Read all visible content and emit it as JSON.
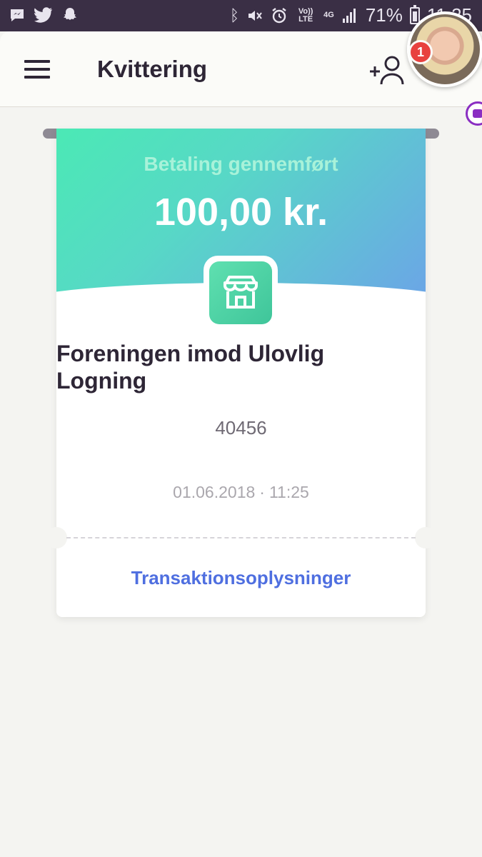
{
  "status_bar": {
    "battery": "71%",
    "time": "11.25",
    "left_icons": [
      "messenger-icon",
      "twitter-icon",
      "snapchat-icon"
    ],
    "right_icons": [
      "bluetooth-icon",
      "mute-icon",
      "alarm-icon",
      "volte-icon",
      "4g-icon",
      "signal-icon",
      "battery-icon"
    ],
    "volte_label": "Vo)) LTE",
    "net_label": "4G"
  },
  "app_bar": {
    "title": "Kvittering",
    "notification_count": "1"
  },
  "receipt": {
    "status": "Betaling gennemført",
    "amount": "100,00 kr.",
    "merchant_name": "Foreningen imod Ulovlig Logning",
    "merchant_id": "40456",
    "date": "01.06.2018",
    "date_time_separator": "·",
    "time": "11:25",
    "details_link": "Transaktionsoplysninger"
  },
  "colors": {
    "gradient_start": "#4be9b5",
    "gradient_end": "#6ba6e6",
    "link": "#4f6fe0",
    "badge": "#e8413f",
    "status_bar": "#3a2f45"
  }
}
